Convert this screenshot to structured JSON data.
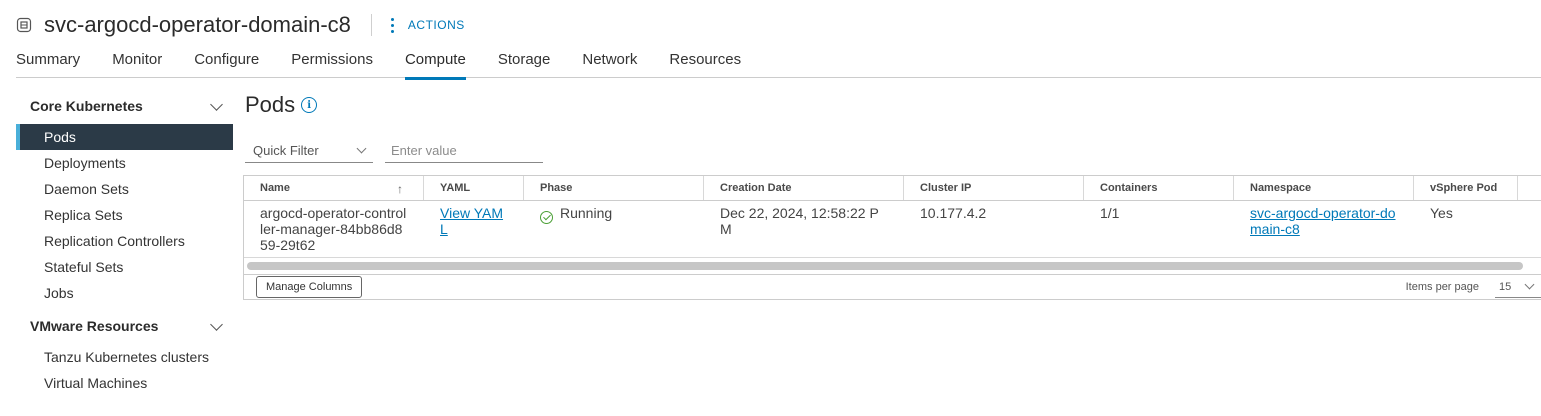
{
  "header": {
    "title": "svc-argocd-operator-domain-c8",
    "actions_label": "ACTIONS",
    "namespace_icon": "namespace-icon"
  },
  "tabs": [
    {
      "label": "Summary"
    },
    {
      "label": "Monitor"
    },
    {
      "label": "Configure"
    },
    {
      "label": "Permissions"
    },
    {
      "label": "Compute",
      "active": true
    },
    {
      "label": "Storage"
    },
    {
      "label": "Network"
    },
    {
      "label": "Resources"
    }
  ],
  "sidebar": {
    "section1": {
      "label": "Core Kubernetes",
      "items": [
        {
          "label": "Pods",
          "active": true
        },
        {
          "label": "Deployments"
        },
        {
          "label": "Daemon Sets"
        },
        {
          "label": "Replica Sets"
        },
        {
          "label": "Replication Controllers"
        },
        {
          "label": "Stateful Sets"
        },
        {
          "label": "Jobs"
        }
      ]
    },
    "section2": {
      "label": "VMware Resources",
      "items": [
        {
          "label": "Tanzu Kubernetes clusters"
        },
        {
          "label": "Virtual Machines"
        }
      ]
    }
  },
  "main": {
    "title": "Pods",
    "filter": {
      "select_label": "Quick Filter",
      "placeholder": "Enter value"
    },
    "columns": [
      "Name",
      "YAML",
      "Phase",
      "Creation Date",
      "Cluster IP",
      "Containers",
      "Namespace",
      "vSphere Pod"
    ],
    "rows": [
      {
        "name": "argocd-operator-controller-manager-84bb86d859-29t62",
        "yaml": "View YAML",
        "phase": "Running",
        "created": "Dec 22, 2024, 12:58:22 PM",
        "cluster_ip": "10.177.4.2",
        "containers": "1/1",
        "namespace": "svc-argocd-operator-domain-c8",
        "vsphere_pod": "Yes"
      }
    ],
    "footer": {
      "manage_columns": "Manage Columns",
      "items_per_page_label": "Items per page",
      "items_per_page": "15"
    }
  },
  "colors": {
    "accent": "#0079b8",
    "nav_active_bg": "#2b3a47",
    "nav_active_border": "#49afd9",
    "success": "#4a9f35"
  }
}
